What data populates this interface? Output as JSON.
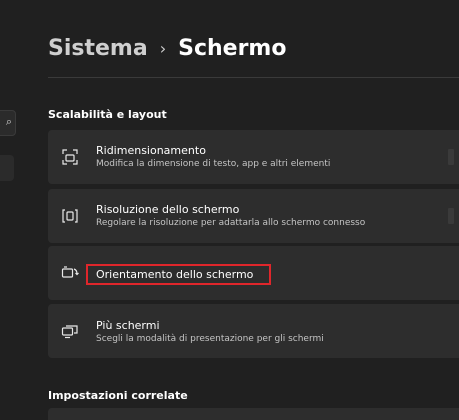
{
  "breadcrumb": {
    "parent": "Sistema",
    "separator": "›",
    "current": "Schermo"
  },
  "sections": {
    "scale_layout": "Scalabilità e layout",
    "related": "Impostazioni correlate"
  },
  "cards": [
    {
      "icon": "resize-icon",
      "title": "Ridimensionamento",
      "description": "Modifica la dimensione di testo, app e altri elementi"
    },
    {
      "icon": "resolution-icon",
      "title": "Risoluzione dello schermo",
      "description": "Regolare la risoluzione per adattarla allo schermo connesso"
    },
    {
      "icon": "orientation-icon",
      "title": "Orientamento dello schermo",
      "description": ""
    },
    {
      "icon": "multi-display-icon",
      "title": "Più schermi",
      "description": "Scegli la modalità di presentazione per gli schermi"
    }
  ],
  "colors": {
    "background": "#202020",
    "card": "#2d2d2d",
    "highlight": "#e0262b"
  }
}
